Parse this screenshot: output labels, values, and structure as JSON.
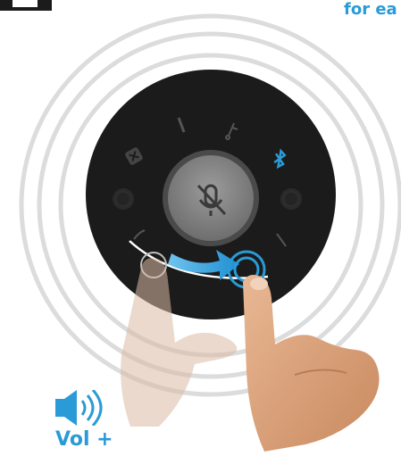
{
  "header": {
    "partial_text": "for ea"
  },
  "volume": {
    "label": "Vol +",
    "icon": "speaker-volume-up-icon"
  },
  "device": {
    "icons": [
      "nfc-icon",
      "microphone-line-icon",
      "usb-icon",
      "bluetooth-icon",
      "mic-mute-icon",
      "speaker-grille-left-icon",
      "speaker-grille-right-icon"
    ],
    "gesture": "swipe-right-arrow"
  },
  "colors": {
    "accent": "#2a9bd6",
    "device_body": "#1b1b1b",
    "ring": "#d9d9d9",
    "skin": "#d9a07a"
  }
}
